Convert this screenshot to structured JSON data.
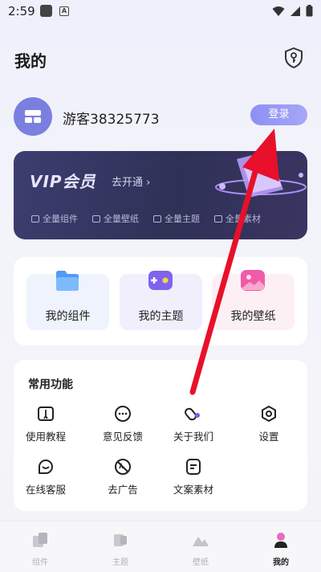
{
  "status": {
    "time": "2:59",
    "badge": "A"
  },
  "header": {
    "title": "我的"
  },
  "user": {
    "name": "游客38325773",
    "login_label": "登录"
  },
  "vip": {
    "title": "VIP会员",
    "open_label": "去开通 ›",
    "features": [
      "全量组件",
      "全量壁纸",
      "全量主题",
      "全量素材"
    ]
  },
  "quick": [
    {
      "label": "我的组件"
    },
    {
      "label": "我的主题"
    },
    {
      "label": "我的壁纸"
    }
  ],
  "functions": {
    "title": "常用功能",
    "items": [
      {
        "label": "使用教程"
      },
      {
        "label": "意见反馈"
      },
      {
        "label": "关于我们"
      },
      {
        "label": "设置"
      },
      {
        "label": "在线客服"
      },
      {
        "label": "去广告"
      },
      {
        "label": "文案素材"
      }
    ]
  },
  "tabs": [
    {
      "label": "组件"
    },
    {
      "label": "主题"
    },
    {
      "label": "壁纸"
    },
    {
      "label": "我的"
    }
  ],
  "colors": {
    "accent": "#8d8ff5",
    "vip_bg": "#2f3157",
    "arrow": "#e8102a"
  }
}
